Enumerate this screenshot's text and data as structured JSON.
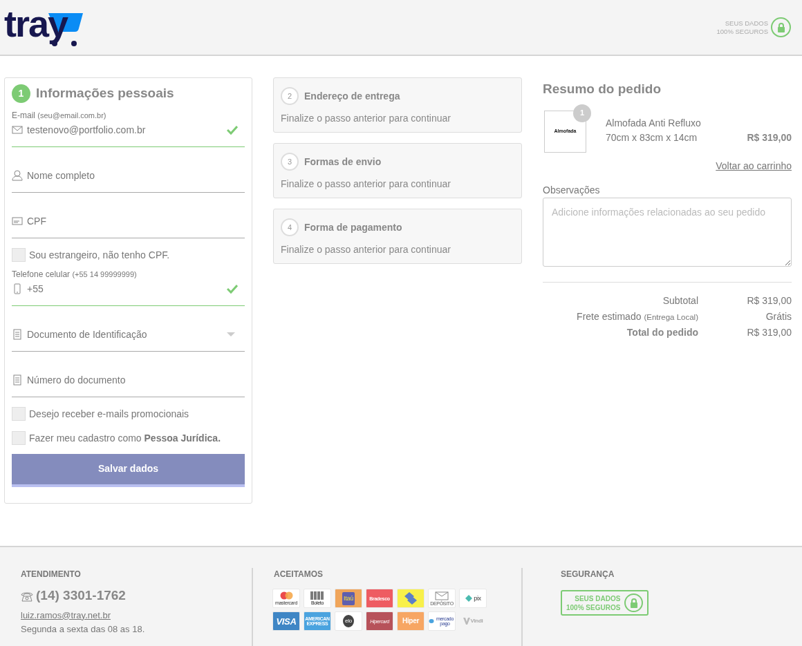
{
  "header": {
    "logo": "tray",
    "security_lines": [
      "SEUS DADOS",
      "100% SEGUROS"
    ]
  },
  "personal": {
    "step": "1",
    "title": "Informações pessoais",
    "fields": [
      {
        "kind": "input",
        "label": "E-mail",
        "hint": "(seu@email.com.br)",
        "value": "testenovo@portfolio.com.br",
        "valid": true
      },
      {
        "kind": "input",
        "placeholder": "Nome completo",
        "valid": false
      },
      {
        "kind": "input",
        "placeholder": "CPF",
        "valid": false
      },
      {
        "kind": "checkbox",
        "text": "Sou estrangeiro, não tenho CPF.",
        "checked": false
      },
      {
        "kind": "input",
        "label": "Telefone celular",
        "hint": "(+55 14 99999999)",
        "value": "+55",
        "valid": true
      },
      {
        "kind": "select",
        "placeholder": "Documento de Identificação",
        "valid": false
      },
      {
        "kind": "input",
        "placeholder": "Número do documento",
        "valid": false
      },
      {
        "kind": "checkbox",
        "text": "Desejo receber e-mails promocionais",
        "checked": false
      },
      {
        "kind": "checkbox",
        "text": "Fazer meu cadastro como **Pessoa Jurídica.**",
        "checked": false
      }
    ],
    "button": "Salvar dados"
  },
  "steps": [
    {
      "number": "2",
      "title": "Endereço de entrega",
      "message": "Finalize o passo anterior para continuar"
    },
    {
      "number": "3",
      "title": "Formas de envio",
      "message": "Finalize o passo anterior para continuar"
    },
    {
      "number": "4",
      "title": "Forma de pagamento",
      "message": "Finalize o passo anterior para continuar"
    }
  ],
  "summary": {
    "title": "Resumo do pedido",
    "item": {
      "quantity": "1",
      "thumb_text": "Almofada",
      "name": "Almofada Anti Refluxo",
      "variant": "70cm x 83cm x 14cm",
      "price": "R$ 319,00"
    },
    "back_link": "Voltar ao carrinho",
    "notes": {
      "label": "Observações",
      "placeholder": "Adicione informações relacionadas ao seu pedido"
    },
    "totals": [
      {
        "label": "Subtotal",
        "value": "R$ 319,00",
        "bold": false
      },
      {
        "label": "Frete estimado",
        "note": "(Entrega Local)",
        "value": "Grátis",
        "bold": false
      },
      {
        "label": "Total do pedido",
        "value": "R$ 319,00",
        "bold": true
      }
    ]
  },
  "footer": {
    "contact": {
      "heading": "ATENDIMENTO",
      "phone": "(14) 3301-1762",
      "email": "luiz.ramos@tray.net.br",
      "hours": "Segunda a sexta das 08 as 18."
    },
    "payments": {
      "heading": "ACEITAMOS",
      "methods": [
        {
          "kind": "wordmark",
          "label": "mastercard"
        },
        {
          "kind": "wordmark",
          "label": "Boleto"
        },
        {
          "kind": "wordmark",
          "label": "Itaú"
        },
        {
          "kind": "wordmark",
          "label": "Bradesco"
        },
        {
          "kind": "emblem"
        },
        {
          "kind": "wordmark",
          "label": "DEPÓSITO"
        },
        {
          "kind": "wordmark",
          "label": "pix"
        },
        {
          "kind": "wordmark",
          "label": "VISA"
        },
        {
          "kind": "wordmark",
          "label": "AMERICAN EXPRESS"
        },
        {
          "kind": "wordmark",
          "label": "elo"
        },
        {
          "kind": "wordmark",
          "label": "Hipercard"
        },
        {
          "kind": "wordmark",
          "label": "Hiper"
        },
        {
          "kind": "wordmark",
          "label": "mercado pago"
        },
        {
          "kind": "wordmark",
          "label": "Vindi"
        }
      ]
    },
    "security": {
      "heading": "SEGURANÇA",
      "lines": [
        "SEUS DADOS",
        "100% SEGUROS"
      ]
    }
  }
}
